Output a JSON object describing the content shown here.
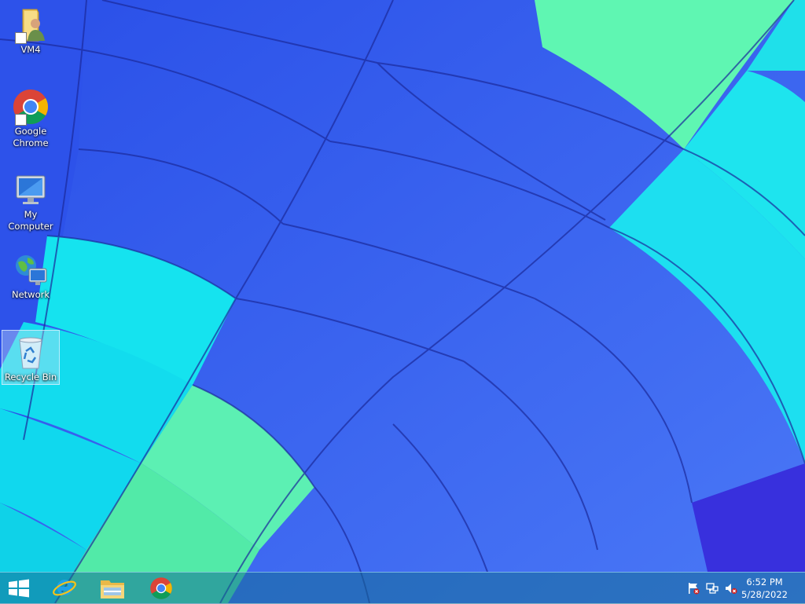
{
  "desktop": {
    "icons": [
      {
        "label": "VM4",
        "icon": "user-folder-icon",
        "shortcut": true
      },
      {
        "label": "Google Chrome",
        "icon": "chrome-icon",
        "shortcut": true
      },
      {
        "label": "My Computer",
        "icon": "computer-icon",
        "shortcut": false
      },
      {
        "label": "Network",
        "icon": "network-icon",
        "shortcut": false
      },
      {
        "label": "Recycle Bin",
        "icon": "recycle-bin-icon",
        "shortcut": false,
        "selected": true
      }
    ]
  },
  "taskbar": {
    "pinned": [
      {
        "icon": "start-windows-logo-icon"
      },
      {
        "icon": "internet-explorer-icon"
      },
      {
        "icon": "file-explorer-icon"
      },
      {
        "icon": "chrome-icon"
      }
    ],
    "tray": [
      {
        "icon": "action-center-flag-icon"
      },
      {
        "icon": "network-status-icon"
      },
      {
        "icon": "volume-muted-icon"
      }
    ],
    "clock": {
      "time": "6:52 PM",
      "date": "5/28/2022"
    }
  },
  "colors": {
    "wallpaper_blue": "#3f6cf4",
    "wallpaper_cyan": "#14e6f0",
    "wallpaper_green": "#5ff5b0",
    "taskbar": "#2a8aaf"
  }
}
